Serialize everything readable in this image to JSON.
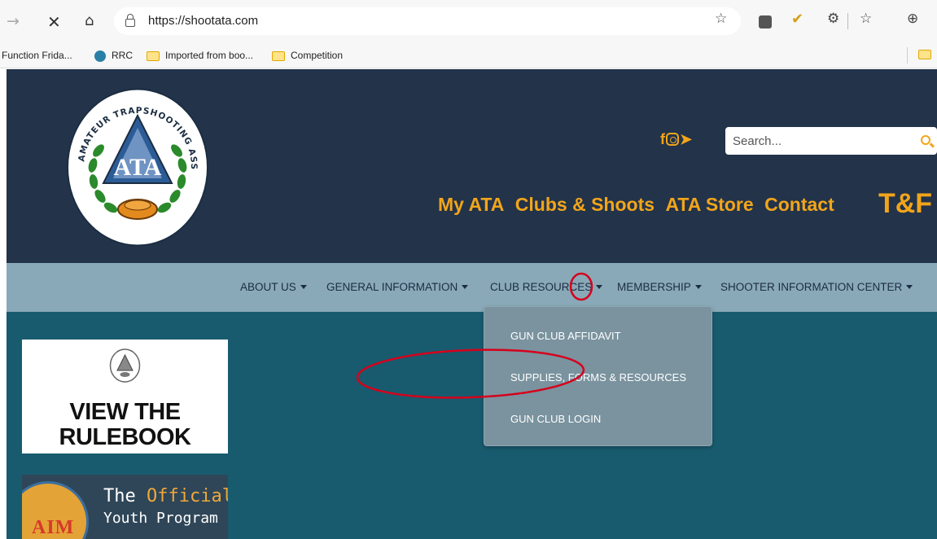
{
  "browser": {
    "url": "https://shootata.com",
    "icons": {
      "back": "arrow-right-icon",
      "stop": "close-icon",
      "home": "home-icon",
      "lock": "lock-icon",
      "favorite": "star-plus-icon",
      "extensions": [
        "extension-dark-icon",
        "check-extension-icon",
        "puzzle-icon"
      ],
      "favorites": "favorites-icon",
      "collections": "collections-icon"
    },
    "bookmarks": [
      {
        "label": "l Function Frida...",
        "icon": "folder-icon"
      },
      {
        "label": "RRC",
        "icon": "rrc-icon"
      },
      {
        "label": "Imported from boo...",
        "icon": "folder-icon"
      },
      {
        "label": "Competition",
        "icon": "folder-icon"
      }
    ]
  },
  "header": {
    "logo_text": "AMATEUR TRAPSHOOTING ASSOCIATION",
    "logo_initials": "ATA",
    "social": {
      "facebook": "f"
    },
    "search_placeholder": "Search...",
    "links": [
      "My ATA",
      "Clubs & Shoots",
      "ATA Store",
      "Contact"
    ],
    "tf_logo": "T&F",
    "brand_color": "#f2a51a"
  },
  "nav": {
    "items": [
      {
        "label": "ABOUT US"
      },
      {
        "label": "GENERAL INFORMATION"
      },
      {
        "label": "CLUB RESOURCES"
      },
      {
        "label": "MEMBERSHIP"
      },
      {
        "label": "SHOOTER INFORMATION CENTER"
      }
    ]
  },
  "dropdown": {
    "items": [
      {
        "label": "GUN CLUB AFFIDAVIT"
      },
      {
        "label": "SUPPLIES, FORMS & RESOURCES"
      },
      {
        "label": "GUN CLUB LOGIN"
      }
    ]
  },
  "content": {
    "rulebook": {
      "line1": "VIEW THE",
      "line2": "RULEBOOK"
    },
    "aim": {
      "letters": "AIM",
      "line1_prefix": "The",
      "line1_accent": "Official",
      "line2": "Youth Program"
    }
  },
  "colors": {
    "header_bg": "#22334a",
    "nav_bg": "#89a9b8",
    "body_bg": "#185b6e",
    "dropdown_bg": "#7a939f",
    "annotation": "#d6001c"
  }
}
